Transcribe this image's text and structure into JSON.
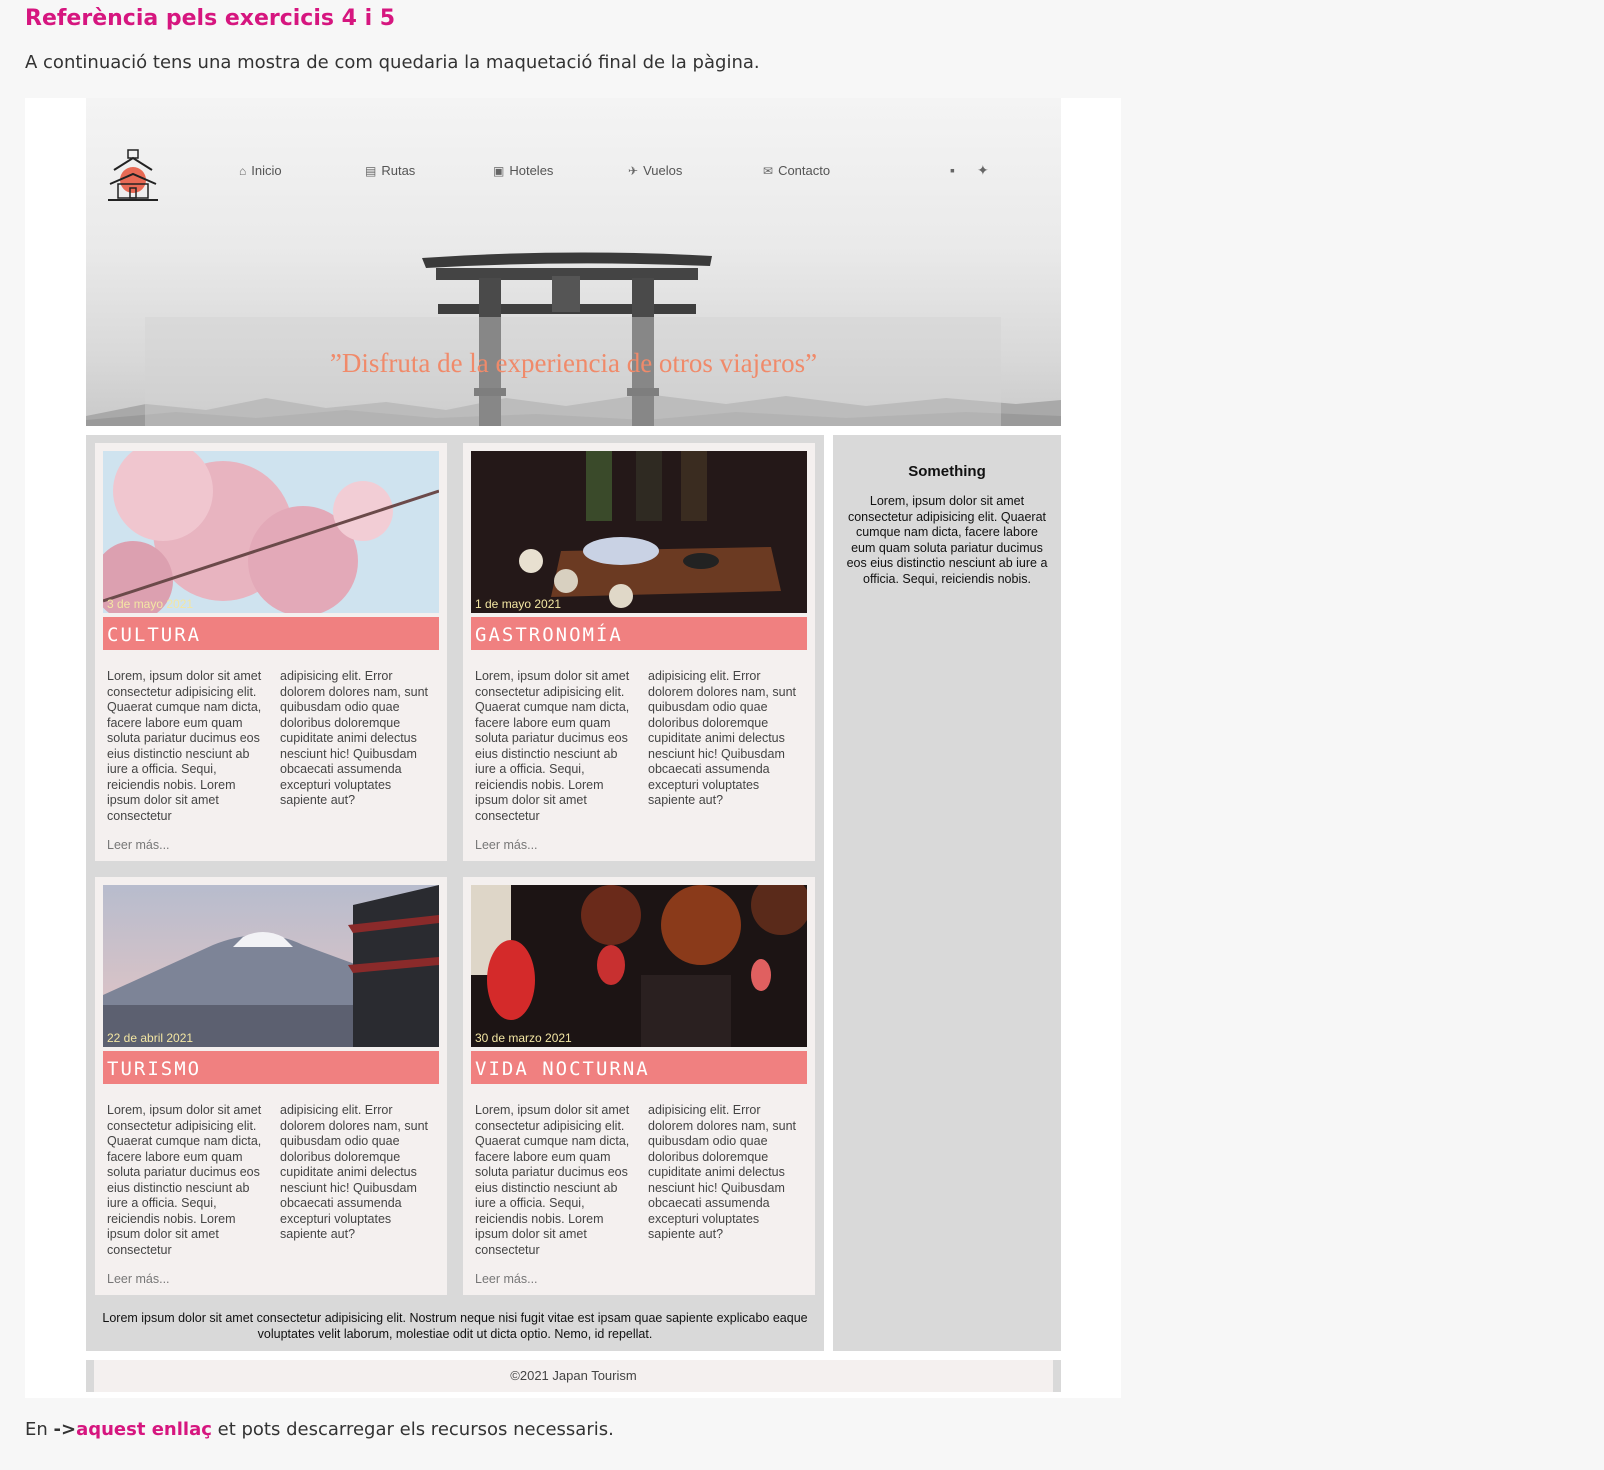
{
  "doc": {
    "title": "Referència pels exercicis 4 i 5",
    "intro": "A continuació tens una mostra de com quedaria la maquetació final de la pàgina.",
    "bottom_prefix": "En",
    "bottom_arrow": "->",
    "bottom_link": "aquest enllaç",
    "bottom_suffix": "et pots descarregar els recursos necessaris."
  },
  "site": {
    "nav": [
      {
        "label": "Inicio",
        "icon": "home-icon"
      },
      {
        "label": "Rutas",
        "icon": "map-icon"
      },
      {
        "label": "Hoteles",
        "icon": "hotel-icon"
      },
      {
        "label": "Vuelos",
        "icon": "plane-icon"
      },
      {
        "label": "Contacto",
        "icon": "envelope-icon"
      }
    ],
    "social": [
      "facebook-icon",
      "twitter-icon"
    ],
    "tagline": "”Disfruta de la experiencia de otros viajeros”",
    "cards": [
      {
        "date": "3 de mayo 2021",
        "label": "CULTURA",
        "image": "cherry-blossom",
        "more": "Leer más..."
      },
      {
        "date": "1 de mayo 2021",
        "label": "GASTRONOMÍA",
        "image": "sake-and-food",
        "more": "Leer más..."
      },
      {
        "date": "22 de abril 2021",
        "label": "TURISMO",
        "image": "mount-fuji-pagoda",
        "more": "Leer más..."
      },
      {
        "date": "30 de marzo 2021",
        "label": "VIDA NOCTURNA",
        "image": "night-street-lanterns",
        "more": "Leer más..."
      }
    ],
    "card_col1": "Lorem, ipsum dolor sit amet consectetur adipisicing elit. Quaerat cumque nam dicta, facere labore eum quam soluta pariatur ducimus eos eius distinctio nesciunt ab iure a officia. Sequi, reiciendis nobis. Lorem ipsum dolor sit amet consectetur",
    "card_col2": "adipisicing elit. Error dolorem dolores nam, sunt quibusdam odio quae doloribus doloremque cupiditate animi delectus nesciunt hic! Quibusdam obcaecati assumenda excepturi voluptates sapiente aut?",
    "main_footer": "Lorem ipsum dolor sit amet consectetur adipisicing elit. Nostrum neque nisi fugit vitae est ipsam quae sapiente explicabo eaque voluptates velit laborum, molestiae odit ut dicta optio. Nemo, id repellat.",
    "aside": {
      "title": "Something",
      "text": "Lorem, ipsum dolor sit amet consectetur adipisicing elit. Quaerat cumque nam dicta, facere labore eum quam soluta pariatur ducimus eos eius distinctio nesciunt ab iure a officia. Sequi, reiciendis nobis."
    },
    "footer": "©2021 Japan Tourism"
  },
  "colors": {
    "accent": "#d6167f",
    "card_label": "#f08080",
    "tagline": "#f08a6a"
  }
}
